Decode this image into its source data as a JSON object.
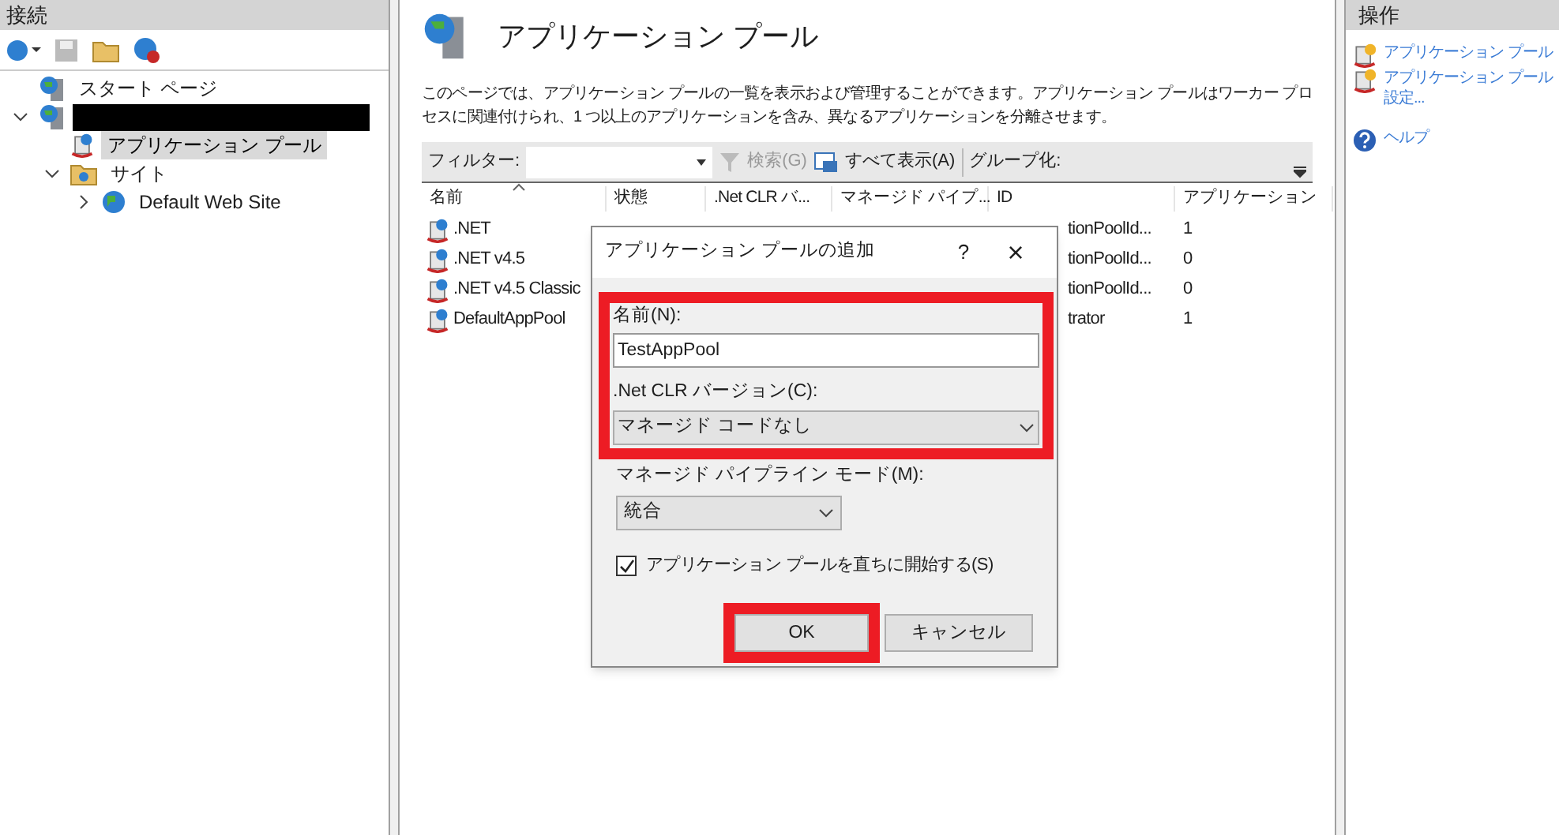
{
  "connections": {
    "title": "接続",
    "tree": [
      {
        "kind": "start",
        "label": "スタート ページ",
        "selected": false
      },
      {
        "kind": "server",
        "expanded": true,
        "children": [
          {
            "kind": "pool",
            "label": "アプリケーション プール",
            "selected": true
          },
          {
            "kind": "folder",
            "label": "サイト",
            "expanded": true,
            "selected": false,
            "children": [
              {
                "kind": "site",
                "label": "Default Web Site",
                "expanded": false,
                "selected": false
              }
            ]
          }
        ]
      }
    ]
  },
  "main": {
    "title": "アプリケーション プール",
    "description": "このページでは、アプリケーション プールの一覧を表示および管理することができます。アプリケーション プールはワーカー プロセスに関連付けられ、1 つ以上のアプリケーションを含み、異なるアプリケーションを分離させます。",
    "filter_label": "フィルター:",
    "search_button": "検索(G)",
    "show_all_button": "すべて表示(A)",
    "group_label": "グループ化:",
    "columns": [
      "名前",
      "状態",
      ".Net CLR バ...",
      "マネージド パイプ...",
      "ID",
      "アプリケーション"
    ],
    "rows": [
      {
        "name": ".NET",
        "id": "tionPoolId...",
        "apps": "1"
      },
      {
        "name": ".NET v4.5",
        "id": "tionPoolId...",
        "apps": "0"
      },
      {
        "name": ".NET v4.5 Classic",
        "id": "tionPoolId...",
        "apps": "0"
      },
      {
        "name": "DefaultAppPool",
        "id": "trator",
        "apps": "1"
      }
    ]
  },
  "actions": {
    "title": "操作",
    "items": [
      {
        "kind": "add",
        "lines": [
          "アプリケーション プール"
        ]
      },
      {
        "kind": "defaults",
        "lines": [
          "アプリケーション プール",
          "設定..."
        ]
      },
      {
        "kind": "help",
        "lines": [
          "ヘルプ"
        ]
      }
    ]
  },
  "dialog": {
    "title": "アプリケーション プールの追加",
    "help": "?",
    "close": "×",
    "name_label": "名前(N):",
    "name_value": "TestAppPool",
    "clr_label": ".Net CLR バージョン(C):",
    "clr_value": "マネージド コードなし",
    "pipeline_label": "マネージド パイプライン モード(M):",
    "pipeline_value": "統合",
    "start_label": "アプリケーション プールを直ちに開始する(S)",
    "start_checked": true,
    "ok": "OK",
    "cancel": "キャンセル"
  }
}
